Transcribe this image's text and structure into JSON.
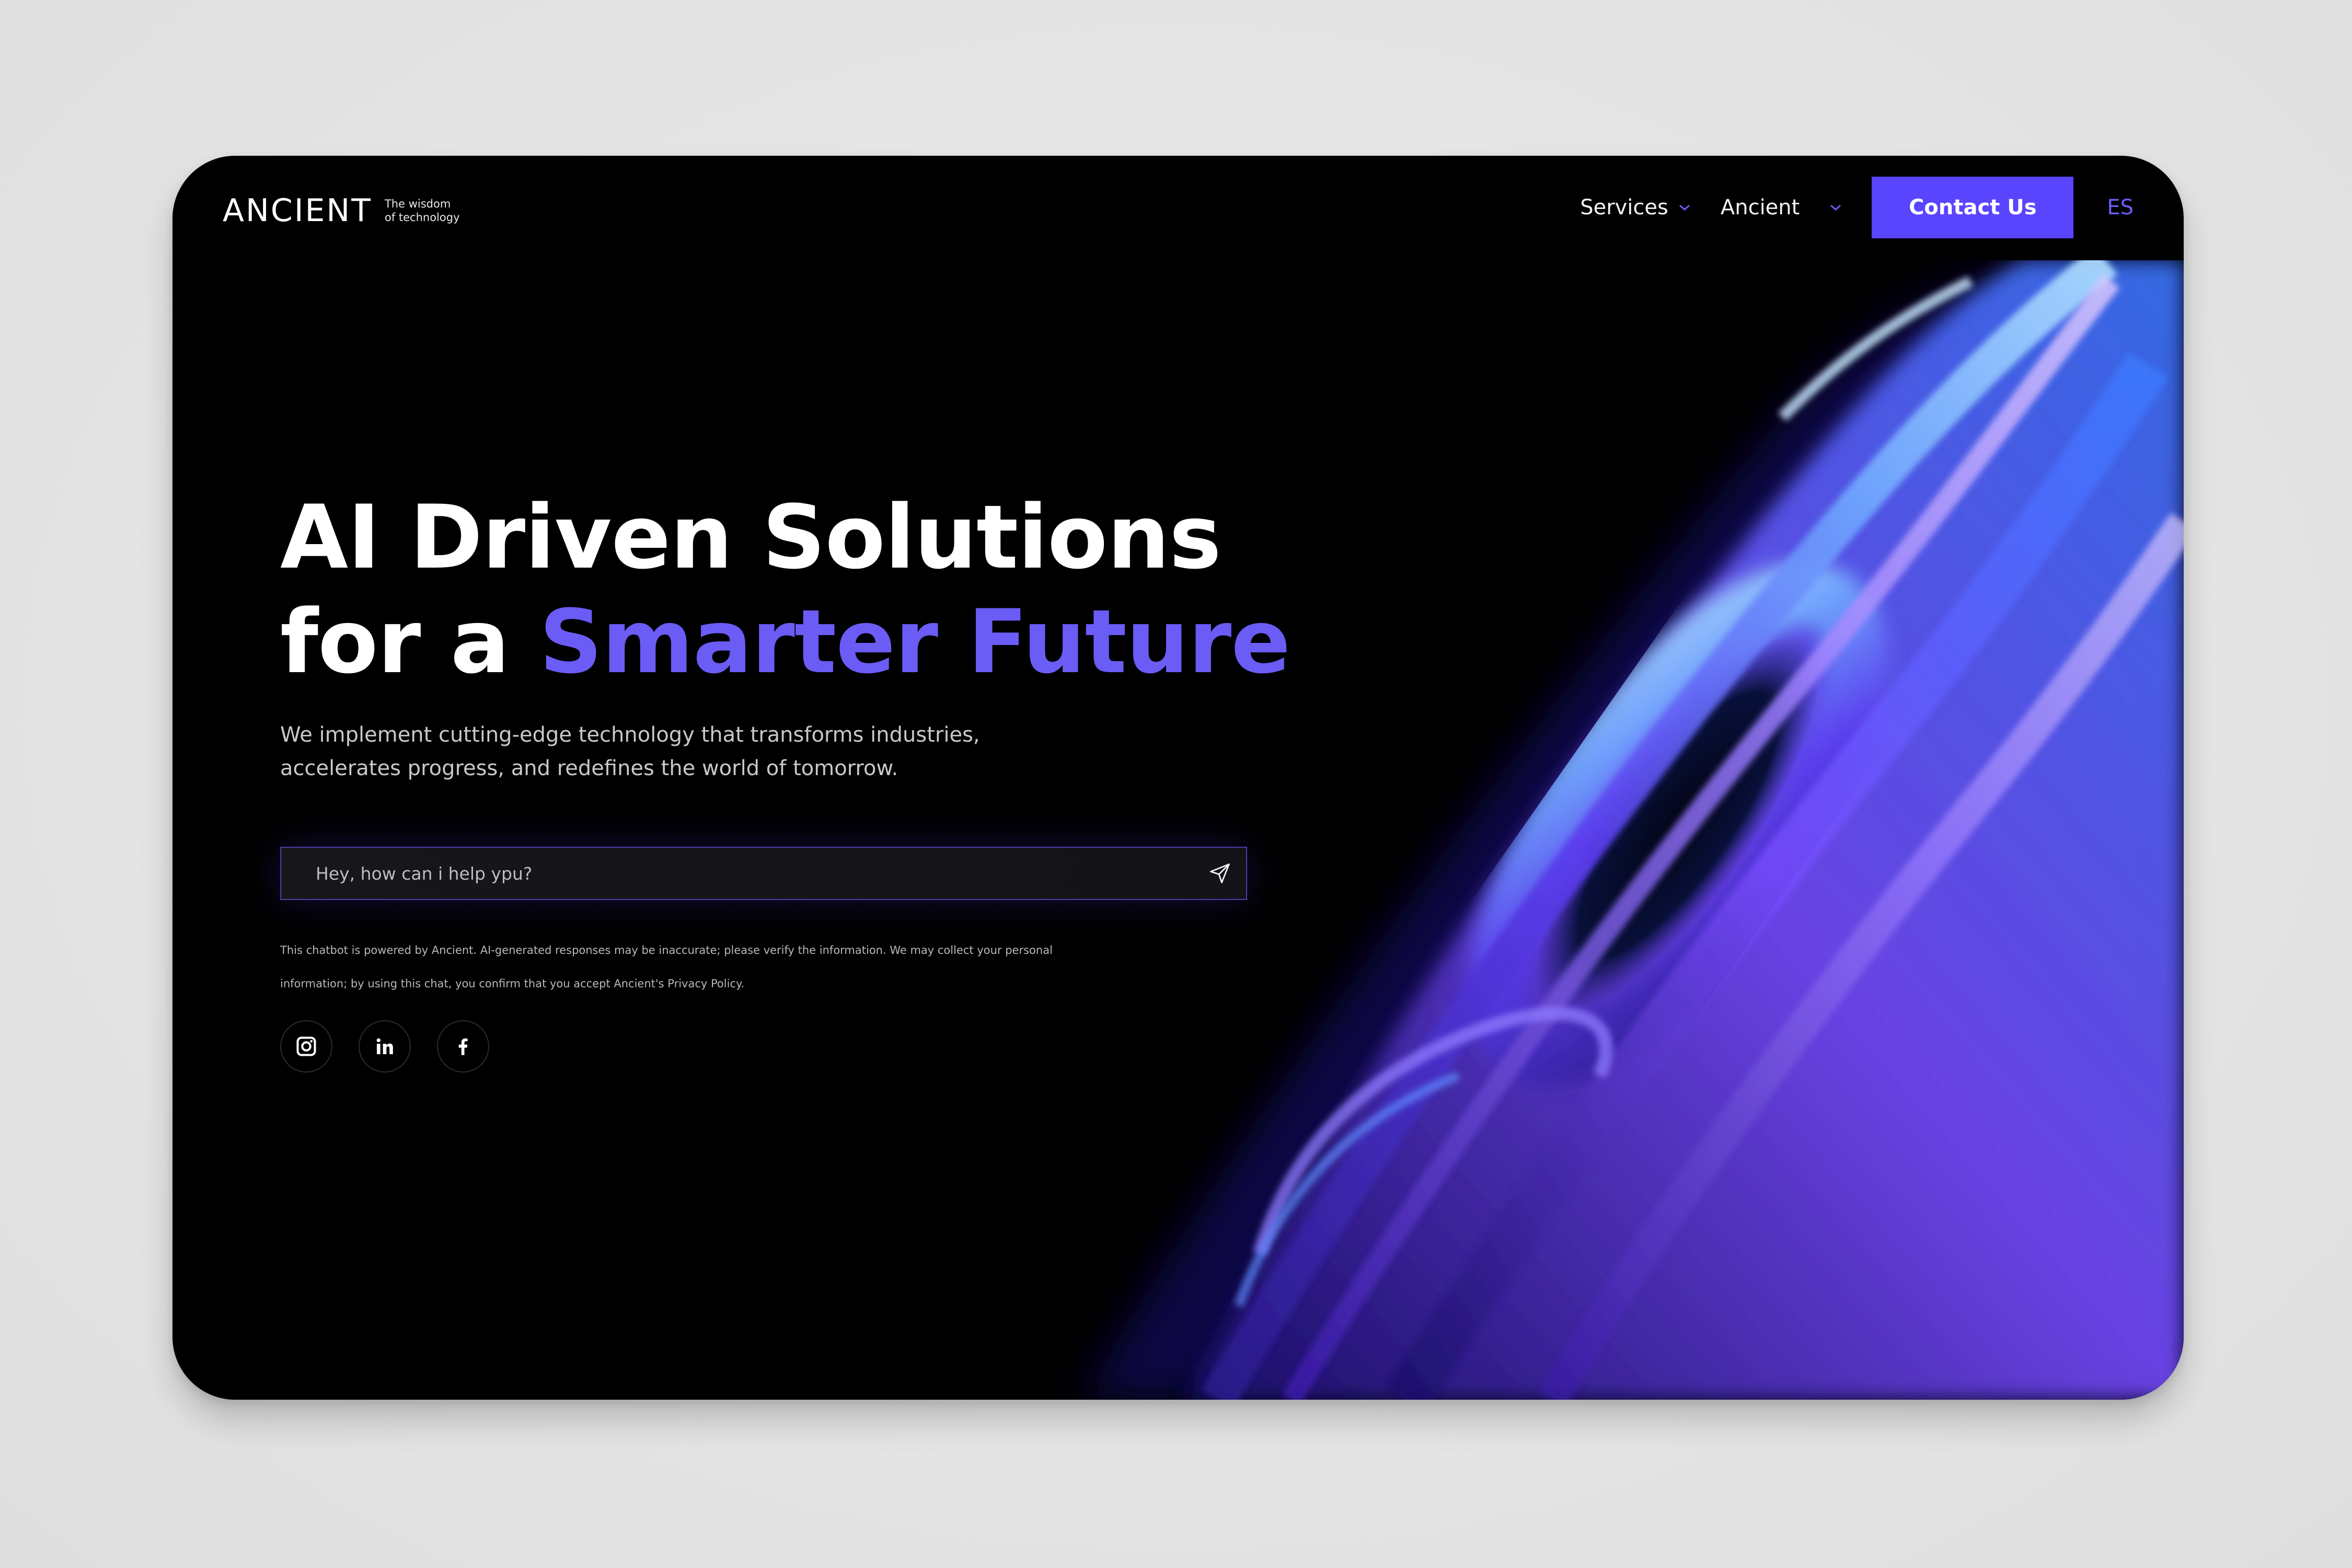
{
  "brand": {
    "name": "ANCIENT",
    "tagline_line1": "The wisdom",
    "tagline_line2": "of technology"
  },
  "nav": {
    "items": [
      {
        "label": "Services",
        "icon": "chevron-down-icon"
      },
      {
        "label": "Ancient",
        "icon": "chevron-down-icon"
      }
    ],
    "contact_label": "Contact Us",
    "language": "ES"
  },
  "hero": {
    "title_line1": "AI Driven Solutions",
    "title_line2_prefix": "for a ",
    "title_line2_accent": "Smarter Future",
    "subtitle": "We implement cutting-edge technology that transforms industries, accelerates progress, and redefines the world of tomorrow."
  },
  "chat": {
    "placeholder": "Hey, how can i help ypu?",
    "value": "",
    "send_icon": "send-icon"
  },
  "disclaimer": "This chatbot is powered by Ancient. AI-generated responses may be inaccurate; please verify the information. We may collect your personal information; by using this chat, you confirm that you accept Ancient's Privacy Policy.",
  "social": [
    {
      "icon": "instagram-icon"
    },
    {
      "icon": "linkedin-icon"
    },
    {
      "icon": "facebook-icon"
    }
  ],
  "colors": {
    "accent": "#5a45ff",
    "accent_text": "#6a5cf5",
    "background": "#000000",
    "page_backdrop": "#e6e6e6"
  }
}
